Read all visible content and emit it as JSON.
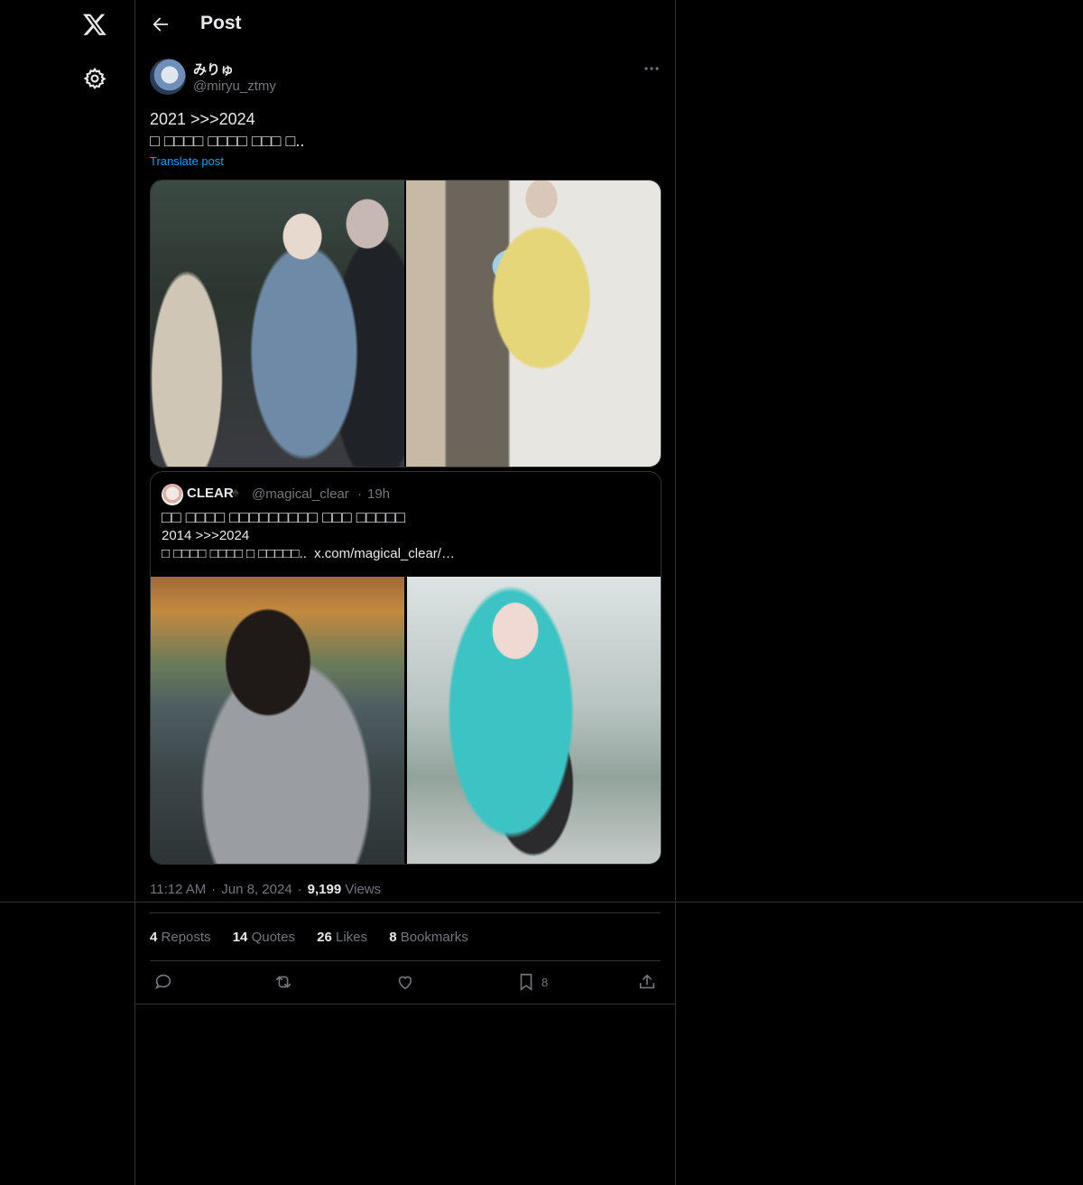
{
  "header": {
    "title": "Post"
  },
  "post": {
    "author_name": "みりゅ",
    "author_handle": "@miryu_ztmy",
    "text": "2021 >>>2024\n□ □□□□ □□□□ □□□ □..",
    "translate_label": "Translate post",
    "timestamp_time": "11:12 AM",
    "timestamp_date": "Jun 8, 2024",
    "views_count": "9,199",
    "views_label": "Views"
  },
  "quote": {
    "name": "CLEAR",
    "badge": "♠",
    "handle": "@magical_clear",
    "separator": "·",
    "time": "19h",
    "line1": "□□ □□□□ □□□□□□□□□ □□□ □□□□□",
    "line2": "2014  >>>2024",
    "line3": "□ □□□□ □□□□ □ □□□□□..",
    "link": "x.com/magical_clear/…"
  },
  "stats": {
    "reposts_count": "4",
    "reposts_label": "Reposts",
    "quotes_count": "14",
    "quotes_label": "Quotes",
    "likes_count": "26",
    "likes_label": "Likes",
    "bookmarks_count": "8",
    "bookmarks_label": "Bookmarks"
  },
  "actions": {
    "bookmark_count": "8"
  },
  "icons": [
    "x-logo-icon",
    "gear-icon",
    "back-arrow-icon",
    "more-icon",
    "reply-icon",
    "repost-icon",
    "like-icon",
    "bookmark-icon",
    "share-icon"
  ]
}
